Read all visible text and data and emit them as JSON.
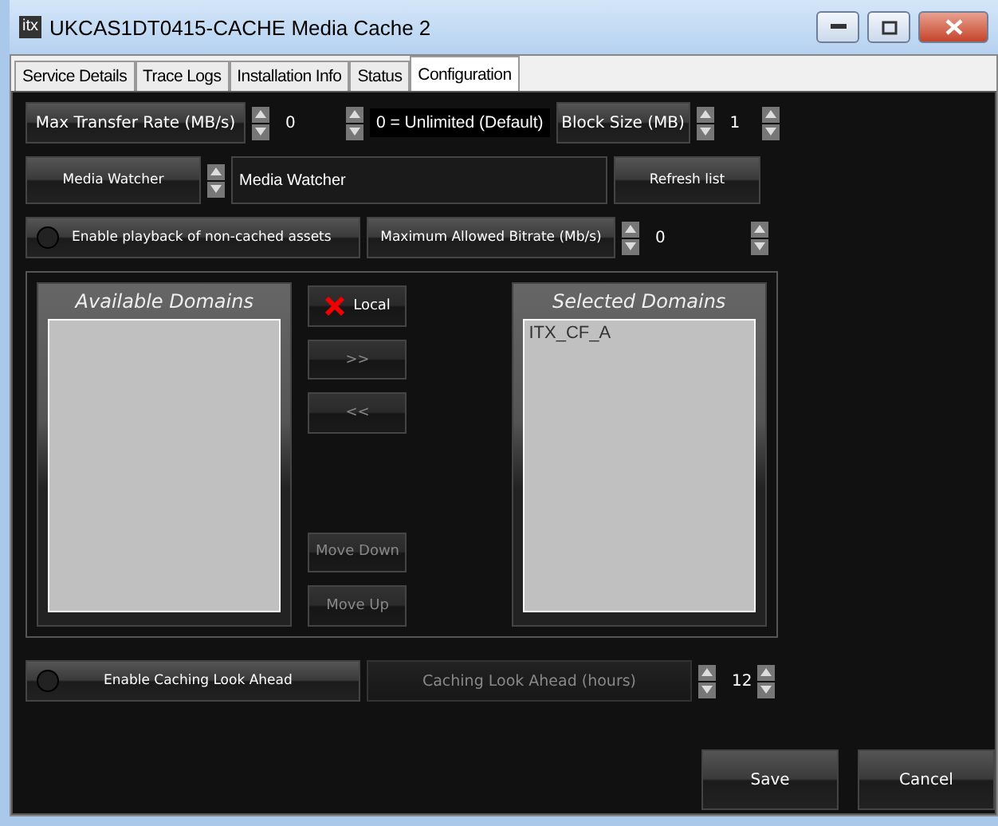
{
  "window": {
    "icon_text": "itx",
    "title": "UKCAS1DT0415-CACHE Media Cache 2"
  },
  "tabs": [
    {
      "label": "Service Details",
      "selected": false
    },
    {
      "label": "Trace Logs",
      "selected": false
    },
    {
      "label": "Installation Info",
      "selected": false
    },
    {
      "label": "Status",
      "selected": false
    },
    {
      "label": "Configuration",
      "selected": true
    }
  ],
  "max_transfer_rate": {
    "label": "Max Transfer Rate (MB/s)",
    "value": "0",
    "note": "0 = Unlimited (Default)"
  },
  "block_size": {
    "label": "Block Size (MB)",
    "value": "1"
  },
  "media_watcher": {
    "label": "Media Watcher",
    "value": "Media Watcher"
  },
  "refresh_button": "Refresh list",
  "playback_toggle": {
    "label": "Enable playback of non-cached assets",
    "on": false
  },
  "max_bitrate": {
    "label": "Maximum Allowed Bitrate (Mb/s)",
    "value": "0"
  },
  "available_domains": {
    "title": "Available Domains"
  },
  "selected_domains": {
    "title": "Selected Domains",
    "items": [
      {
        "label": "ITX_CF_A",
        "selected": false
      }
    ]
  },
  "middle_buttons": [
    {
      "kind": "local",
      "label": "Local",
      "disabled": false
    },
    {
      "kind": "move",
      "label": ">>",
      "disabled": true
    },
    {
      "kind": "move",
      "label": "<<",
      "disabled": true
    },
    {
      "kind": "gap"
    },
    {
      "kind": "move",
      "label": "Move Down",
      "disabled": true
    },
    {
      "kind": "move",
      "label": "Move Up",
      "disabled": true
    }
  ],
  "look_ahead_toggle": {
    "label": "Enable Caching Look Ahead",
    "on": false
  },
  "look_ahead_hours": {
    "label": "Caching Look Ahead (hours)",
    "value": "12",
    "disabled": true
  },
  "footer_buttons": [
    "Save",
    "Cancel"
  ]
}
